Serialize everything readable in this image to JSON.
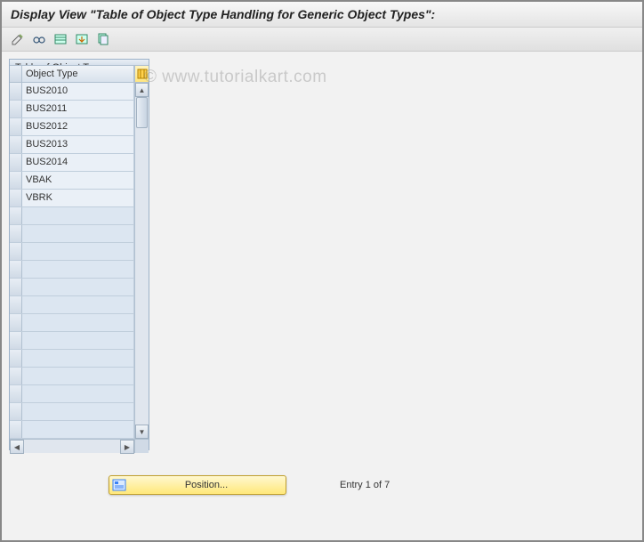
{
  "header": {
    "title": "Display View \"Table of Object Type Handling for Generic Object Types\":"
  },
  "watermark": "© www.tutorialkart.com",
  "toolbar": {
    "icons": [
      "edit-icon",
      "glasses-icon",
      "table-icon",
      "export-icon",
      "copy-icon"
    ]
  },
  "table": {
    "title": "Table of Object Typ...",
    "column_header": "Object Type",
    "rows": [
      "BUS2010",
      "BUS2011",
      "BUS2012",
      "BUS2013",
      "BUS2014",
      "VBAK",
      "VBRK"
    ],
    "empty_rows": 13
  },
  "footer": {
    "position_label": "Position...",
    "entry_text": "Entry 1 of 7"
  }
}
